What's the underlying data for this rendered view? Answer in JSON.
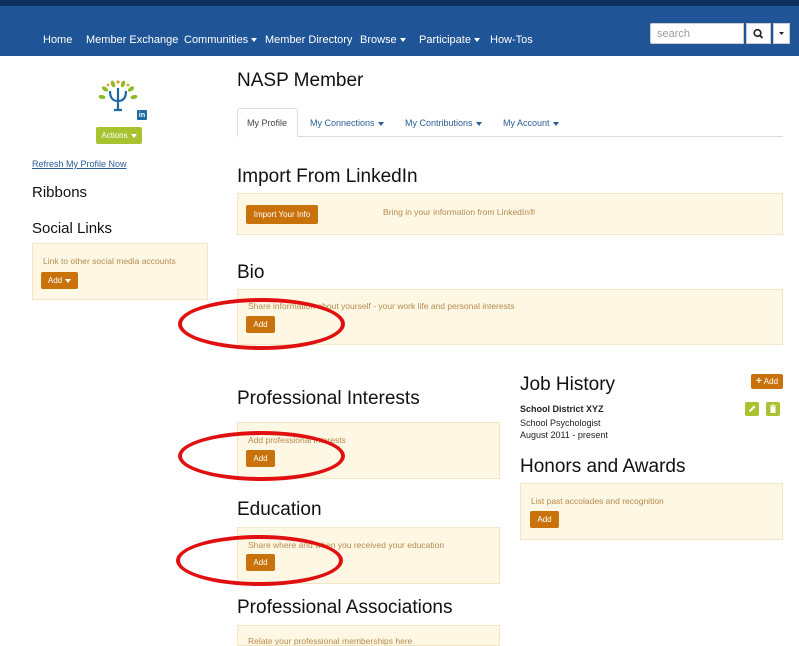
{
  "nav": {
    "items": [
      {
        "label": "Home",
        "dropdown": false
      },
      {
        "label": "Member Exchange",
        "dropdown": false
      },
      {
        "label": "Communities",
        "dropdown": true
      },
      {
        "label": "Member Directory",
        "dropdown": false
      },
      {
        "label": "Browse",
        "dropdown": true
      },
      {
        "label": "Participate",
        "dropdown": true
      },
      {
        "label": "How-Tos",
        "dropdown": false
      }
    ],
    "search_placeholder": "search"
  },
  "sidebar": {
    "actions_label": "Actions",
    "refresh_link": "Refresh My Profile Now",
    "ribbons_heading": "Ribbons",
    "social_heading": "Social Links",
    "social_text": "Link to other social media accounts",
    "social_add": "Add",
    "linkedin_badge": "in"
  },
  "main": {
    "title": "NASP Member",
    "tabs": [
      {
        "label": "My Profile",
        "active": true
      },
      {
        "label": "My Connections",
        "active": false
      },
      {
        "label": "My Contributions",
        "active": false
      },
      {
        "label": "My Account",
        "active": false
      }
    ],
    "import": {
      "heading": "Import From LinkedIn",
      "button": "Import Your Info",
      "text": "Bring in your information from LinkedIn®"
    },
    "bio": {
      "heading": "Bio",
      "text": "Share information about yourself - your work life and personal interests",
      "add": "Add"
    },
    "interests": {
      "heading": "Professional Interests",
      "text": "Add professional interests",
      "add": "Add"
    },
    "education": {
      "heading": "Education",
      "text": "Share where and when you received your education",
      "add": "Add"
    },
    "associations": {
      "heading": "Professional Associations",
      "text": "Relate your professional memberships here"
    },
    "job": {
      "heading": "Job History",
      "add": "Add",
      "employer": "School District XYZ",
      "role": "School Psychologist",
      "dates": "August 2011 - present"
    },
    "honors": {
      "heading": "Honors and Awards",
      "text": "List past accolades and recognition",
      "add": "Add"
    }
  },
  "colors": {
    "nav_bg": "#1f5496",
    "accent_orange": "#c9720c",
    "panel_bg": "#fdf7e4",
    "actions_green": "#a9c22f",
    "annotation_red": "#e11010"
  }
}
